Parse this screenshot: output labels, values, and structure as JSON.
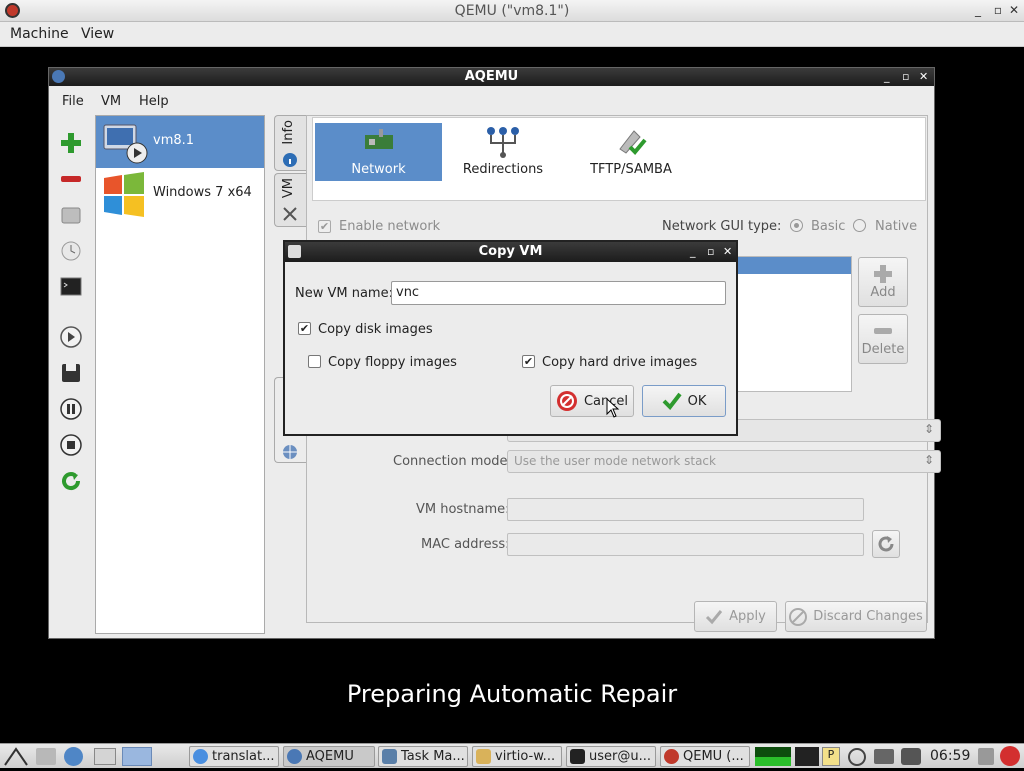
{
  "qemu": {
    "title": "QEMU (\"vm8.1\")",
    "menu": [
      "Machine",
      "View"
    ],
    "controls": [
      "_",
      "▫",
      "✕"
    ]
  },
  "boot_message": "Preparing Automatic Repair",
  "aqemu": {
    "title": "AQEMU",
    "menu": [
      "File",
      "VM",
      "Help"
    ],
    "controls": [
      "_",
      "▫",
      "✕"
    ],
    "vms": [
      {
        "name": "vm8.1",
        "selected": true
      },
      {
        "name": "Windows 7 x64",
        "selected": false
      }
    ],
    "side_tabs": [
      "Info",
      "VM"
    ],
    "sections": [
      {
        "label": "Network",
        "selected": true
      },
      {
        "label": "Redirections",
        "selected": false
      },
      {
        "label": "TFTP/SAMBA",
        "selected": false
      }
    ],
    "enable_network": "Enable network",
    "network_gui_type_label": "Network GUI type:",
    "gui_type_basic": "Basic",
    "gui_type_native": "Native",
    "add_label": "Add",
    "delete_label": "Delete",
    "connection_mode_label": "Connection mode:",
    "connection_mode_value": "Use the user mode network stack",
    "vm_hostname_label": "VM hostname:",
    "mac_address_label": "MAC address:",
    "apply_label": "Apply",
    "discard_label": "Discard Changes",
    "accent": "#5b8dc9"
  },
  "dialog": {
    "title": "Copy VM",
    "new_vm_name_label": "New VM name:",
    "new_vm_name_value": "vnc",
    "copy_disk_images": "Copy disk images",
    "copy_disk_checked": true,
    "copy_floppy_images": "Copy floppy images",
    "copy_floppy_checked": false,
    "copy_hdd_images": "Copy hard drive images",
    "copy_hdd_checked": true,
    "cancel_label": "Cancel",
    "ok_label": "OK",
    "controls": [
      "_",
      "▫",
      "✕"
    ]
  },
  "taskbar": {
    "tasks": [
      "translat...",
      "AQEMU",
      "Task Ma...",
      "virtio-w...",
      "user@u...",
      "QEMU (..."
    ],
    "clock": "06:59"
  }
}
